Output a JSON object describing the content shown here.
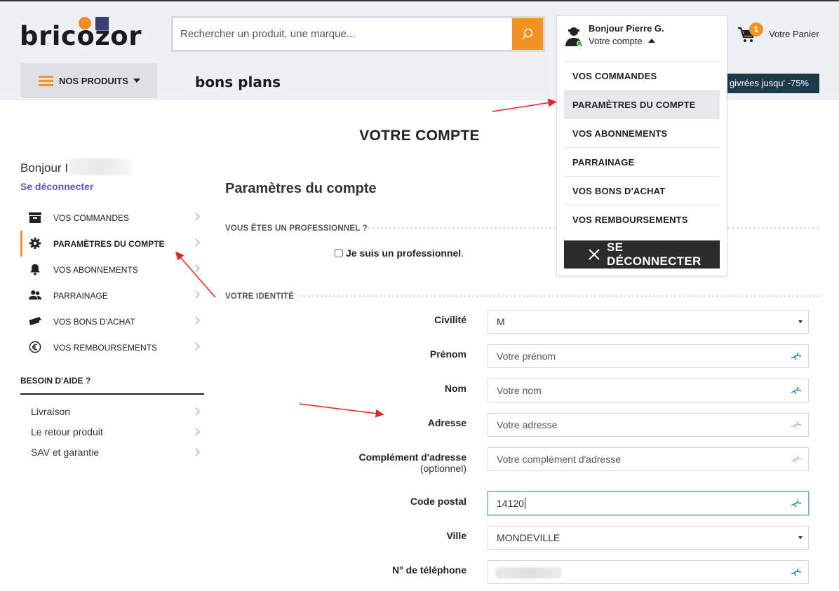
{
  "brand": {
    "name": "bricozor",
    "accent": "#f39321",
    "navy": "#3a3f73"
  },
  "search": {
    "placeholder": "Rechercher un produit, une marque..."
  },
  "account": {
    "greeting": "Bonjour Pierre G.",
    "label": "Votre compte",
    "menu": [
      {
        "label": "VOS COMMANDES"
      },
      {
        "label": "PARAMÈTRES DU COMPTE"
      },
      {
        "label": "VOS ABONNEMENTS"
      },
      {
        "label": "PARRAINAGE"
      },
      {
        "label": "VOS BONS D'ACHAT"
      },
      {
        "label": "VOS REMBOURSEMENTS"
      }
    ],
    "logout_button": "SE DÉCONNECTER"
  },
  "cart": {
    "count": "1",
    "label": "Votre Panier"
  },
  "nav": {
    "products_label": "NOS PRODUITS",
    "bons_plans": "bons plans",
    "promo": "givrées jusqu' -75%"
  },
  "page": {
    "title": "VOTRE COMPTE"
  },
  "sidebar": {
    "greeting": "Bonjour I",
    "logout_link": "Se déconnecter",
    "items": [
      {
        "label": "VOS COMMANDES",
        "icon": "archive-icon"
      },
      {
        "label": "PARAMÈTRES DU COMPTE",
        "icon": "gear-icon"
      },
      {
        "label": "VOS ABONNEMENTS",
        "icon": "bell-icon"
      },
      {
        "label": "PARRAINAGE",
        "icon": "users-icon"
      },
      {
        "label": "VOS BONS D'ACHAT",
        "icon": "ticket-icon"
      },
      {
        "label": "VOS REMBOURSEMENTS",
        "icon": "euro-icon"
      }
    ],
    "help_title": "BESOIN D'AIDE ?",
    "help_items": [
      {
        "label": "Livraison"
      },
      {
        "label": "Le retour produit"
      },
      {
        "label": "SAV et garantie"
      }
    ]
  },
  "main": {
    "section_title": "Paramètres du compte",
    "pro_heading": "VOUS ÊTES UN PROFESSIONNEL ?",
    "pro_checkbox": "Je suis un professionnel",
    "pro_checkbox_suffix": ".",
    "identity_heading": "VOTRE IDENTITÉ",
    "form": {
      "civilite": {
        "label": "Civilité",
        "value": "M"
      },
      "prenom": {
        "label": "Prénom",
        "placeholder": "Votre prénom"
      },
      "nom": {
        "label": "Nom",
        "placeholder": "Votre nom"
      },
      "adresse": {
        "label": "Adresse",
        "placeholder": "Votre adresse"
      },
      "complement": {
        "label": "Complément d'adresse",
        "optional": "(optionnel)",
        "placeholder": "Votre complément d'adresse"
      },
      "code_postal": {
        "label": "Code postal",
        "value": "14120"
      },
      "ville": {
        "label": "Ville",
        "value": "MONDEVILLE"
      },
      "telephone": {
        "label": "N° de téléphone"
      }
    }
  }
}
